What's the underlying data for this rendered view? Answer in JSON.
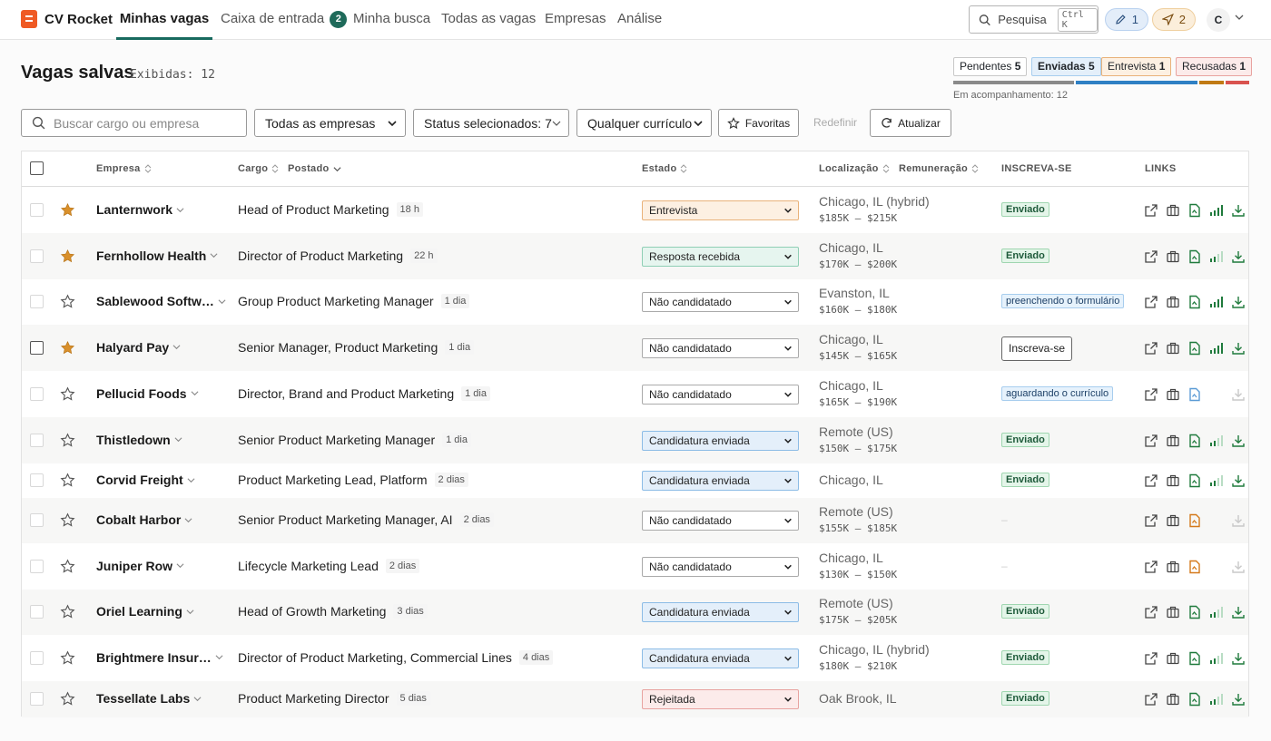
{
  "app": {
    "name": "CV Rocket",
    "nav": [
      {
        "label": "Minhas vagas",
        "active": true
      },
      {
        "label": "Caixa de entrada",
        "count": "2"
      },
      {
        "label": "Minha busca"
      },
      {
        "label": "Todas as vagas"
      },
      {
        "label": "Empresas"
      },
      {
        "label": "Análise"
      }
    ],
    "search_label": "Pesquisa",
    "search_shortcut": "Ctrl K",
    "pill_edit_count": "1",
    "pill_send_count": "2",
    "avatar_initial": "C"
  },
  "header": {
    "title": "Vagas salvas",
    "shown": "Exibidas: 12",
    "stats": [
      {
        "label": "Pendentes",
        "value": "5"
      },
      {
        "label": "Enviadas",
        "value": "5"
      },
      {
        "label": "Entrevista",
        "value": "1"
      },
      {
        "label": "Recusadas",
        "value": "1"
      }
    ],
    "tracking": "Em acompanhamento: 12"
  },
  "filters": {
    "search_placeholder": "Buscar cargo ou empresa",
    "company": "Todas as empresas",
    "status": "Status selecionados: 7",
    "resume": "Qualquer currículo",
    "favorites": "Favoritas",
    "reset": "Redefinir",
    "refresh": "Atualizar"
  },
  "columns": {
    "company": "Empresa",
    "role": "Cargo",
    "posted": "Postado",
    "status": "Estado",
    "location": "Localização",
    "pay": "Remuneração",
    "apply": "INSCREVA-SE",
    "links": "LINKS"
  },
  "rows": [
    {
      "company": "Lanternwork",
      "starred": true,
      "role": "Head of Product Marketing",
      "age": "18 h",
      "status": "Entrevista",
      "status_kind": "entrevista",
      "location": "Chicago, IL (hybrid)",
      "pay": "$185K – $215K",
      "apply": "Enviado",
      "apply_kind": "sent",
      "resume_state": "green",
      "signal": "full",
      "download": true
    },
    {
      "company": "Fernhollow Health",
      "starred": true,
      "role": "Director of Product Marketing",
      "age": "22 h",
      "status": "Resposta recebida",
      "status_kind": "resposta",
      "location": "Chicago, IL",
      "pay": "$170K – $200K",
      "apply": "Enviado",
      "apply_kind": "sent",
      "resume_state": "green",
      "signal": "partial",
      "download": true
    },
    {
      "company": "Sablewood Softw…",
      "starred": false,
      "role": "Group Product Marketing Manager",
      "age": "1 dia",
      "status": "Não candidatado",
      "status_kind": "none",
      "location": "Evanston, IL",
      "pay": "$160K – $180K",
      "apply": "preenchendo o formulário",
      "apply_kind": "info",
      "resume_state": "green",
      "signal": "full",
      "download": true
    },
    {
      "company": "Halyard Pay",
      "starred": true,
      "role": "Senior Manager, Product Marketing",
      "age": "1 dia",
      "status": "Não candidatado",
      "status_kind": "none",
      "location": "Chicago, IL",
      "pay": "$145K – $165K",
      "apply": "Inscreva-se",
      "apply_kind": "button",
      "resume_state": "green",
      "signal": "full",
      "download": true
    },
    {
      "company": "Pellucid Foods",
      "starred": false,
      "role": "Director, Brand and Product Marketing",
      "age": "1 dia",
      "status": "Não candidatado",
      "status_kind": "none",
      "location": "Chicago, IL",
      "pay": "$165K – $190K",
      "apply": "aguardando o currículo",
      "apply_kind": "info",
      "resume_state": "blue",
      "signal": "none",
      "download": false
    },
    {
      "company": "Thistledown",
      "starred": false,
      "role": "Senior Product Marketing Manager",
      "age": "1 dia",
      "status": "Candidatura enviada",
      "status_kind": "enviada",
      "location": "Remote (US)",
      "pay": "$150K – $175K",
      "apply": "Enviado",
      "apply_kind": "sent",
      "resume_state": "green",
      "signal": "partial",
      "download": true
    },
    {
      "company": "Corvid Freight",
      "starred": false,
      "role": "Product Marketing Lead, Platform",
      "age": "2 dias",
      "status": "Candidatura enviada",
      "status_kind": "enviada",
      "location": "Chicago, IL",
      "pay": "",
      "apply": "Enviado",
      "apply_kind": "sent",
      "resume_state": "green",
      "signal": "partial",
      "download": true
    },
    {
      "company": "Cobalt Harbor",
      "starred": false,
      "role": "Senior Product Marketing Manager, AI",
      "age": "2 dias",
      "status": "Não candidatado",
      "status_kind": "none",
      "location": "Remote (US)",
      "pay": "$155K – $185K",
      "apply": "–",
      "apply_kind": "dash",
      "resume_state": "orange",
      "signal": "none",
      "download": false
    },
    {
      "company": "Juniper Row",
      "starred": false,
      "role": "Lifecycle Marketing Lead",
      "age": "2 dias",
      "status": "Não candidatado",
      "status_kind": "none",
      "location": "Chicago, IL",
      "pay": "$130K – $150K",
      "apply": "–",
      "apply_kind": "dash",
      "resume_state": "orange",
      "signal": "none",
      "download": false
    },
    {
      "company": "Oriel Learning",
      "starred": false,
      "role": "Head of Growth Marketing",
      "age": "3 dias",
      "status": "Candidatura enviada",
      "status_kind": "enviada",
      "location": "Remote (US)",
      "pay": "$175K – $205K",
      "apply": "Enviado",
      "apply_kind": "sent",
      "resume_state": "green",
      "signal": "partial",
      "download": true
    },
    {
      "company": "Brightmere Insur…",
      "starred": false,
      "role": "Director of Product Marketing, Commercial Lines",
      "age": "4 dias",
      "status": "Candidatura enviada",
      "status_kind": "enviada",
      "location": "Chicago, IL (hybrid)",
      "pay": "$180K – $210K",
      "apply": "Enviado",
      "apply_kind": "sent",
      "resume_state": "green",
      "signal": "partial",
      "download": true
    },
    {
      "company": "Tessellate Labs",
      "starred": false,
      "role": "Product Marketing Director",
      "age": "5 dias",
      "status": "Rejeitada",
      "status_kind": "rejeitada",
      "location": "Oak Brook, IL",
      "pay": "",
      "apply": "Enviado",
      "apply_kind": "sent",
      "resume_state": "green",
      "signal": "partial",
      "download": true
    }
  ],
  "colors": {
    "accent": "#186a5e",
    "star": "#d9902b",
    "pending": "#8a8a8a",
    "sent": "#2f80c4",
    "interview": "#c07a14",
    "refused": "#d9534f"
  }
}
